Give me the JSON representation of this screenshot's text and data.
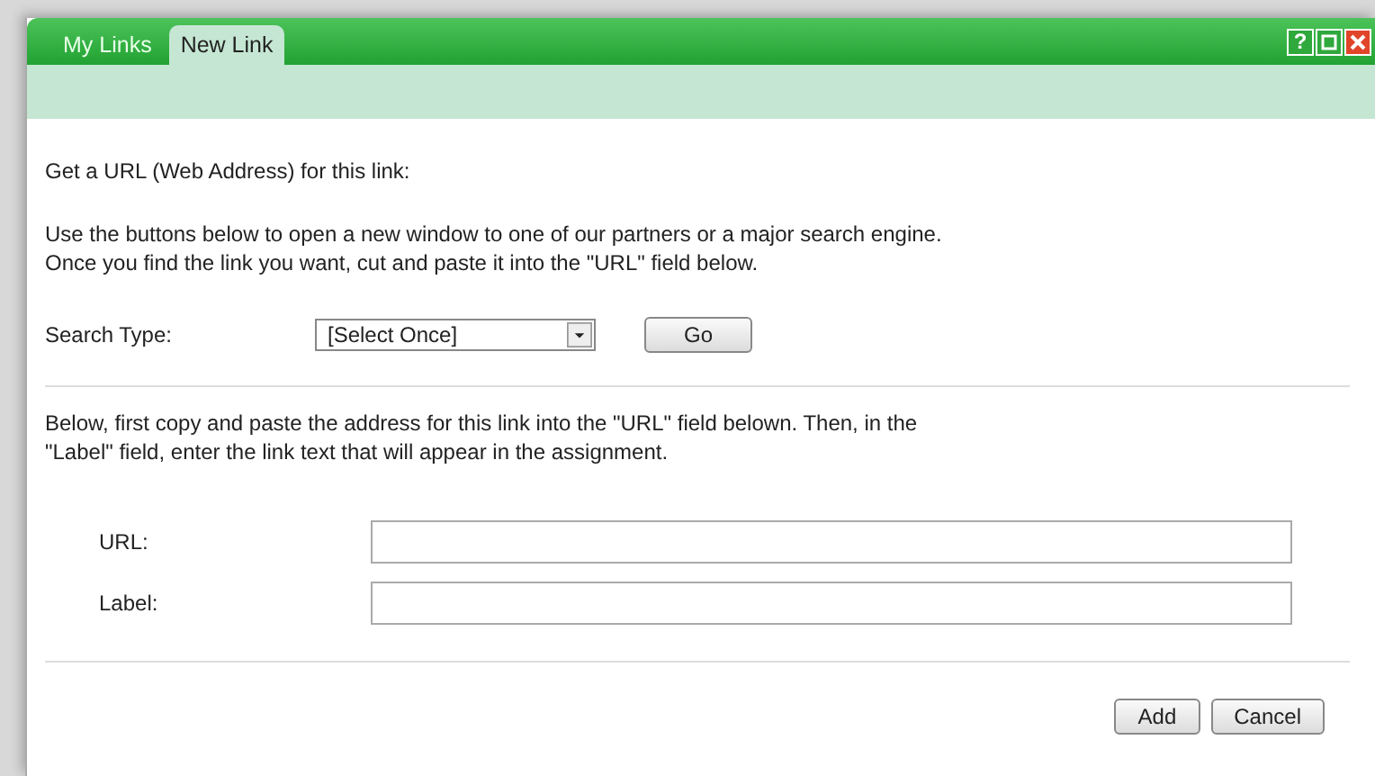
{
  "tabs": [
    {
      "label": "My Links",
      "selected": false
    },
    {
      "label": "New Link",
      "selected": true
    }
  ],
  "window_controls": [
    "?"
  ],
  "intro": "Get a URL (Web Address) for this link:",
  "instructions": [
    "Use the buttons below to open a new window to one of our partners or a major search engine.",
    "Once you find the link you want, cut and paste it into the \"URL\" field below."
  ],
  "search": {
    "label": "Search Type:",
    "value": "[Select Once]",
    "button": "Go"
  },
  "fields_instructions": [
    "Below, first copy and paste the address for this link into the \"URL\" field belown. Then, in the",
    "\"Label\" field, enter the link text that will appear in the assignment."
  ],
  "fields": [
    {
      "label": "URL:"
    },
    {
      "label": "Label:"
    }
  ],
  "buttons": [
    "Add",
    "Cancel"
  ]
}
